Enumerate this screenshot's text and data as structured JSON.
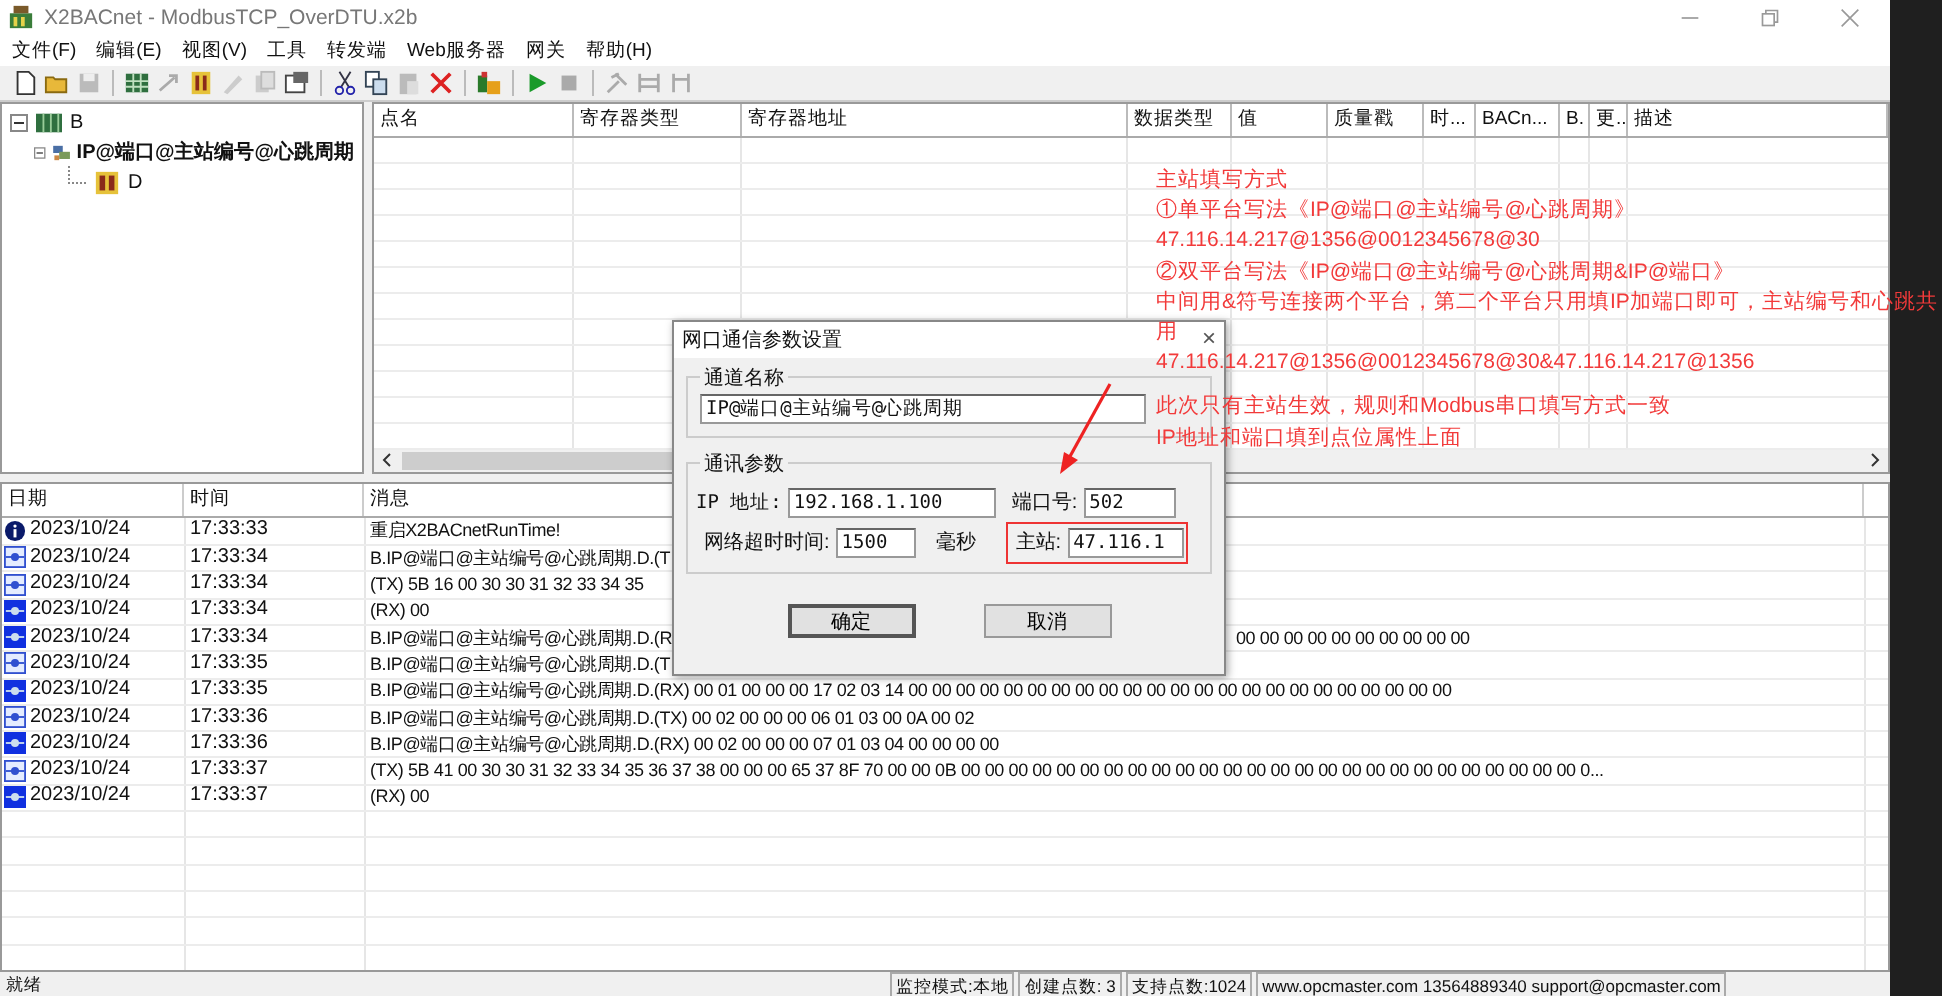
{
  "window": {
    "title": "X2BACnet - ModbusTCP_OverDTU.x2b"
  },
  "menu": [
    "文件(F)",
    "编辑(E)",
    "视图(V)",
    "工具",
    "转发端",
    "Web服务器",
    "网关",
    "帮助(H)"
  ],
  "tree": [
    {
      "label": "B",
      "kind": "device",
      "expanded": true,
      "children": [
        {
          "label": "IP@端口@主站编号@心跳周期",
          "kind": "channel",
          "expanded": true,
          "children": [
            {
              "label": "D",
              "kind": "point"
            }
          ]
        }
      ]
    }
  ],
  "points_table": {
    "columns": [
      "点名",
      "寄存器类型",
      "寄存器地址",
      "数据类型",
      "值",
      "质量戳",
      "时...",
      "BACn...",
      "B.",
      "更..",
      "描述"
    ]
  },
  "annotation": {
    "lines": [
      "主站填写方式",
      "①单平台写法《IP@端口@主站编号@心跳周期》",
      "47.116.14.217@1356@0012345678@30",
      "②双平台写法《IP@端口@主站编号@心跳周期&IP@端口》",
      "中间用&符号连接两个平台，第二个平台只用填IP加端口即可，主站编号和心跳共",
      "用",
      "47.116.14.217@1356@0012345678@30&47.116.14.217@1356"
    ],
    "note": [
      "此次只有主站生效，规则和Modbus串口填写方式一致",
      "IP地址和端口填到点位属性上面"
    ]
  },
  "dialog": {
    "title": "网口通信参数设置",
    "close": "×",
    "channel_group": "通道名称",
    "channel_name": "IP@端口@主站编号@心跳周期",
    "params_group": "通讯参数",
    "ip_label": "IP 地址:",
    "ip": "192.168.1.100",
    "port_label": "端口号:",
    "port": "502",
    "timeout_label": "网络超时时间:",
    "timeout": "1500",
    "timeout_unit": "毫秒",
    "master_label": "主站:",
    "master": "47.116.1",
    "ok": "确定",
    "cancel": "取消"
  },
  "log": {
    "columns": [
      "日期",
      "时间",
      "消息"
    ],
    "rows": [
      {
        "kind": "info",
        "date": "2023/10/24",
        "time": "17:33:33",
        "message": "重启X2BACnetRunTime!"
      },
      {
        "kind": "tx",
        "date": "2023/10/24",
        "time": "17:33:34",
        "message": "B.IP@端口@主站编号@心跳周期.D.(T"
      },
      {
        "kind": "tx",
        "date": "2023/10/24",
        "time": "17:33:34",
        "message": "(TX) 5B 16 00 30 30 31 32 33 34 35"
      },
      {
        "kind": "rx",
        "date": "2023/10/24",
        "time": "17:33:34",
        "message": "(RX) 00"
      },
      {
        "kind": "rx",
        "date": "2023/10/24",
        "time": "17:33:34",
        "message": "B.IP@端口@主站编号@心跳周期.D.(R",
        "message_tail": "00 00 00 00 00 00 00 00 00 00"
      },
      {
        "kind": "tx",
        "date": "2023/10/24",
        "time": "17:33:35",
        "message": "B.IP@端口@主站编号@心跳周期.D.(T"
      },
      {
        "kind": "rx",
        "date": "2023/10/24",
        "time": "17:33:35",
        "message": "B.IP@端口@主站编号@心跳周期.D.(RX) 00 01 00 00 00 17 02 03 14 00 00 00 00 00 00 00 00 00 00 00 00 00 00 00 00 00 00 00 00 00 00 00"
      },
      {
        "kind": "tx",
        "date": "2023/10/24",
        "time": "17:33:36",
        "message": "B.IP@端口@主站编号@心跳周期.D.(TX) 00 02 00 00 00 06 01 03 00 0A 00 02"
      },
      {
        "kind": "rx",
        "date": "2023/10/24",
        "time": "17:33:36",
        "message": "B.IP@端口@主站编号@心跳周期.D.(RX) 00 02 00 00 00 07 01 03 04 00 00 00 00"
      },
      {
        "kind": "tx",
        "date": "2023/10/24",
        "time": "17:33:37",
        "message": "(TX) 5B 41 00 30 30 31 32 33 34 35 36 37 38 00 00 00 65 37 8F 70 00 00 0B 00 00 00 00 00 00 00 00 00 00 00 00 00 00 00 00 00 00 00 00 00 00 00 00 00 00 0..."
      },
      {
        "kind": "rx",
        "date": "2023/10/24",
        "time": "17:33:37",
        "message": "(RX) 00"
      }
    ]
  },
  "status_bar": [
    "就绪",
    "监控模式:本地",
    "创建点数: 3",
    "支持点数:1024",
    "www.opcmaster.com 13564889340 support@opcmaster.com"
  ]
}
